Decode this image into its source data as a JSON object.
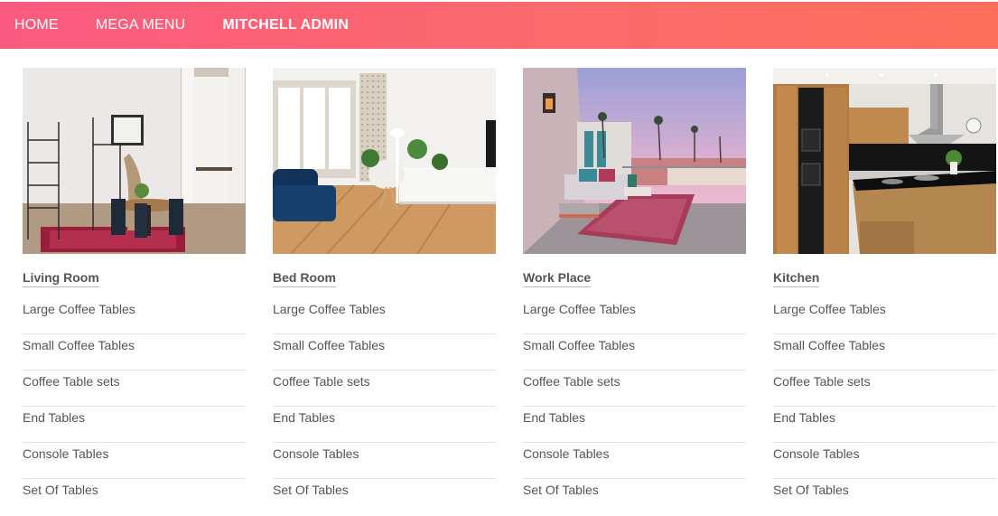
{
  "nav": {
    "items": [
      {
        "label": "HOME"
      },
      {
        "label": "MEGA MENU"
      },
      {
        "label": "MITCHELL ADMIN"
      }
    ]
  },
  "columns": [
    {
      "title": "Living Room",
      "image_name": "living-room-photo",
      "links": [
        "Large Coffee Tables",
        "Small Coffee Tables",
        "Coffee Table sets",
        "End Tables",
        "Console Tables",
        "Set Of Tables"
      ]
    },
    {
      "title": "Bed Room",
      "image_name": "bed-room-photo",
      "links": [
        "Large Coffee Tables",
        "Small Coffee Tables",
        "Coffee Table sets",
        "End Tables",
        "Console Tables",
        "Set Of Tables"
      ]
    },
    {
      "title": "Work Place",
      "image_name": "work-place-photo",
      "links": [
        "Large Coffee Tables",
        "Small Coffee Tables",
        "Coffee Table sets",
        "End Tables",
        "Console Tables",
        "Set Of Tables"
      ]
    },
    {
      "title": "Kitchen",
      "image_name": "kitchen-photo",
      "links": [
        "Large Coffee Tables",
        "Small Coffee Tables",
        "Coffee Table sets",
        "End Tables",
        "Console Tables",
        "Set Of Tables"
      ]
    }
  ],
  "colors": {
    "navbar_start": "#fb5a80",
    "navbar_end": "#fd6d5a",
    "text": "#555555"
  }
}
